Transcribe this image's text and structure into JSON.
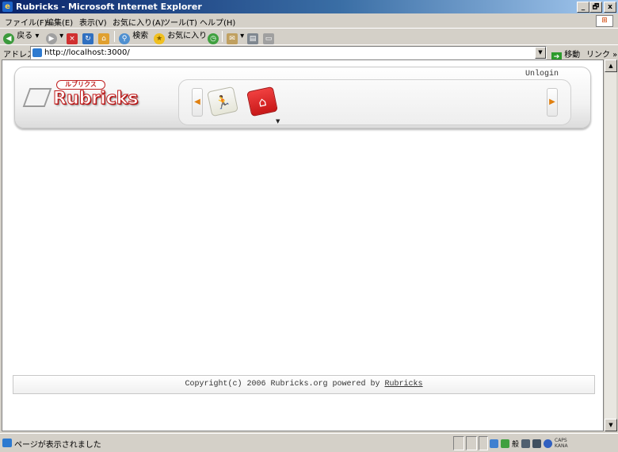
{
  "window": {
    "title": "Rubricks - Microsoft Internet Explorer",
    "controls": [
      "_",
      "🗗",
      "x"
    ]
  },
  "menu": [
    "ファイル(F)",
    "編集(E)",
    "表示(V)",
    "お気に入り(A)",
    "ツール(T)",
    "ヘルプ(H)"
  ],
  "toolbar": {
    "back_label": "戻る",
    "search_label": "検索",
    "favorites_label": "お気に入り"
  },
  "address": {
    "label": "アドレス(D)",
    "url": "http://localhost:3000/",
    "go_label": "移動",
    "links_label": "リンク »"
  },
  "site": {
    "logo_text": "Rubricks",
    "logo_badge": "ルブリクス",
    "unlogin_label": "Unlogin",
    "footer_text": "Copyright(c) 2006 Rubricks.org powered by",
    "footer_link": "Rubricks"
  },
  "status": {
    "text": "ページが表示されました",
    "ime": "般",
    "caps": "CAPS",
    "kana": "KANA"
  }
}
